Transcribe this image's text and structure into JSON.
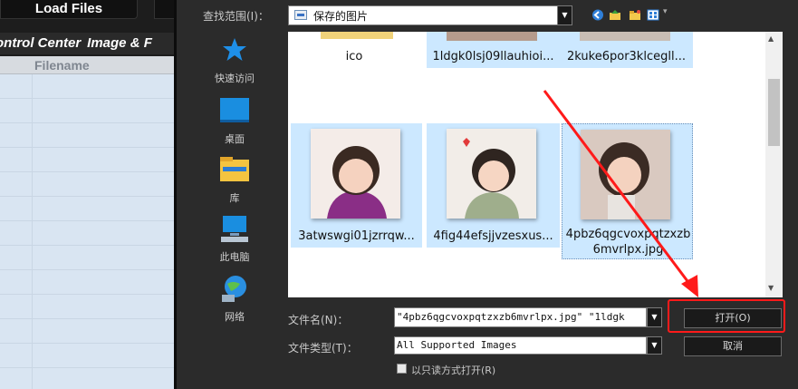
{
  "app": {
    "load_files_label": "Load Files",
    "tab_control": "ontrol Center",
    "tab_image": "Image & F",
    "filename_header": "Filename"
  },
  "dialog": {
    "lookin_label": "查找范围(I)：",
    "lookin_value": "保存的图片",
    "places": [
      {
        "label": "快速访问",
        "icon": "star-icon"
      },
      {
        "label": "桌面",
        "icon": "desktop-icon"
      },
      {
        "label": "库",
        "icon": "library-folder-icon"
      },
      {
        "label": "此电脑",
        "icon": "computer-icon"
      },
      {
        "label": "网络",
        "icon": "network-globe-icon"
      }
    ],
    "files": [
      {
        "label": "ico"
      },
      {
        "label": "1ldgk0lsj09llauhioi..."
      },
      {
        "label": "2kuke6por3klcegll..."
      },
      {
        "label": "3atwswgi01jzrrqw..."
      },
      {
        "label": "4fig44efsjjvzesxus..."
      },
      {
        "label": "4pbz6qgcvoxpqtzxzb",
        "label2": "6mvrlpx.jpg"
      }
    ],
    "filename_label": "文件名(N)：",
    "filename_value": "\"4pbz6qgcvoxpqtzxzb6mvrlpx.jpg\" \"1ldgk",
    "filetype_label": "文件类型(T)：",
    "filetype_value": "All Supported Images",
    "readonly_label": "以只读方式打开(R)",
    "open_button": "打开(O)",
    "cancel_button": "取消"
  },
  "colors": {
    "selection": "#cce8ff",
    "annotation_red": "#ff1a1a"
  }
}
